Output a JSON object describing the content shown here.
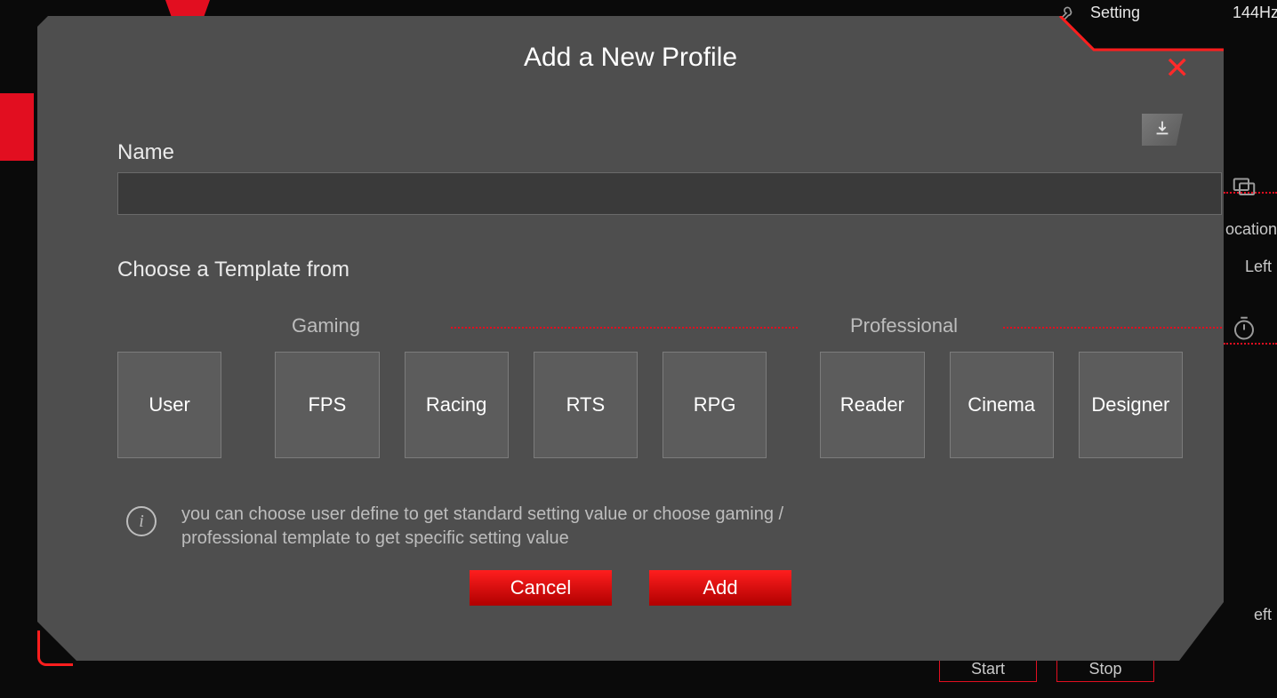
{
  "background": {
    "setting_label": "Setting",
    "refresh_rate": "144Hz",
    "right_location": "ocation",
    "right_left1": "Left",
    "right_left2": "eft",
    "start_label": "Start",
    "stop_label": "Stop"
  },
  "modal": {
    "title": "Add a New Profile",
    "name_label": "Name",
    "name_value": "",
    "choose_label": "Choose a Template from",
    "sections": {
      "gaming_label": "Gaming",
      "professional_label": "Professional"
    },
    "tiles": {
      "user": "User",
      "fps": "FPS",
      "racing": "Racing",
      "rts": "RTS",
      "rpg": "RPG",
      "reader": "Reader",
      "cinema": "Cinema",
      "designer": "Designer"
    },
    "info_text": "you can choose user define to get standard setting value or choose gaming / professional template to get specific setting value",
    "cancel_label": "Cancel",
    "add_label": "Add"
  }
}
